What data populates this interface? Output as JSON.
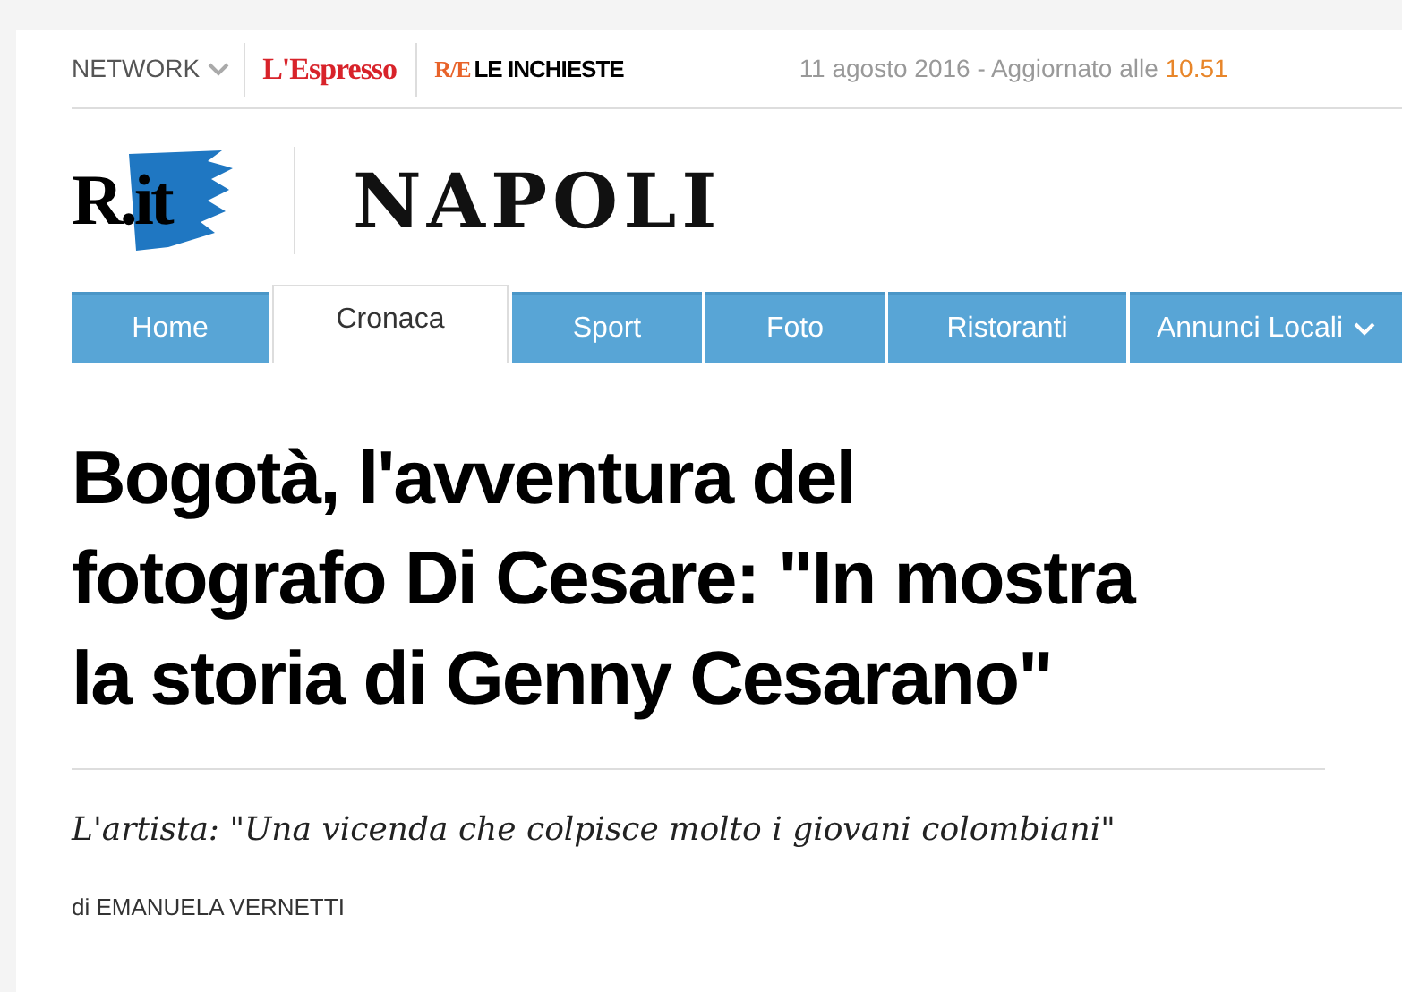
{
  "topbar": {
    "network": "NETWORK",
    "logos": [
      {
        "kind": "espresso",
        "text": "L'Espresso"
      },
      {
        "kind": "inchieste",
        "mark": "R/E",
        "text": "LE INCHIESTE"
      }
    ],
    "date": "11 agosto 2016 - Aggiornato alle",
    "time": "10.51"
  },
  "masthead": {
    "logo": "R.it",
    "section": "NAPOLI"
  },
  "tabs": [
    {
      "label": "Home",
      "selected": false,
      "dropdown": false
    },
    {
      "label": "Cronaca",
      "selected": true,
      "dropdown": false
    },
    {
      "label": "Sport",
      "selected": false,
      "dropdown": false
    },
    {
      "label": "Foto",
      "selected": false,
      "dropdown": false
    },
    {
      "label": "Ristoranti",
      "selected": false,
      "dropdown": false
    },
    {
      "label": "Annunci Locali",
      "selected": false,
      "dropdown": true
    }
  ],
  "article": {
    "headline": "Bogotà, l'avventura del fotografo Di Cesare: \"In mostra la storia di Genny Cesarano\"",
    "summary": "L'artista: \"Una vicenda che colpisce molto i giovani colombiani\"",
    "byline": "di EMANUELA VERNETTI"
  }
}
